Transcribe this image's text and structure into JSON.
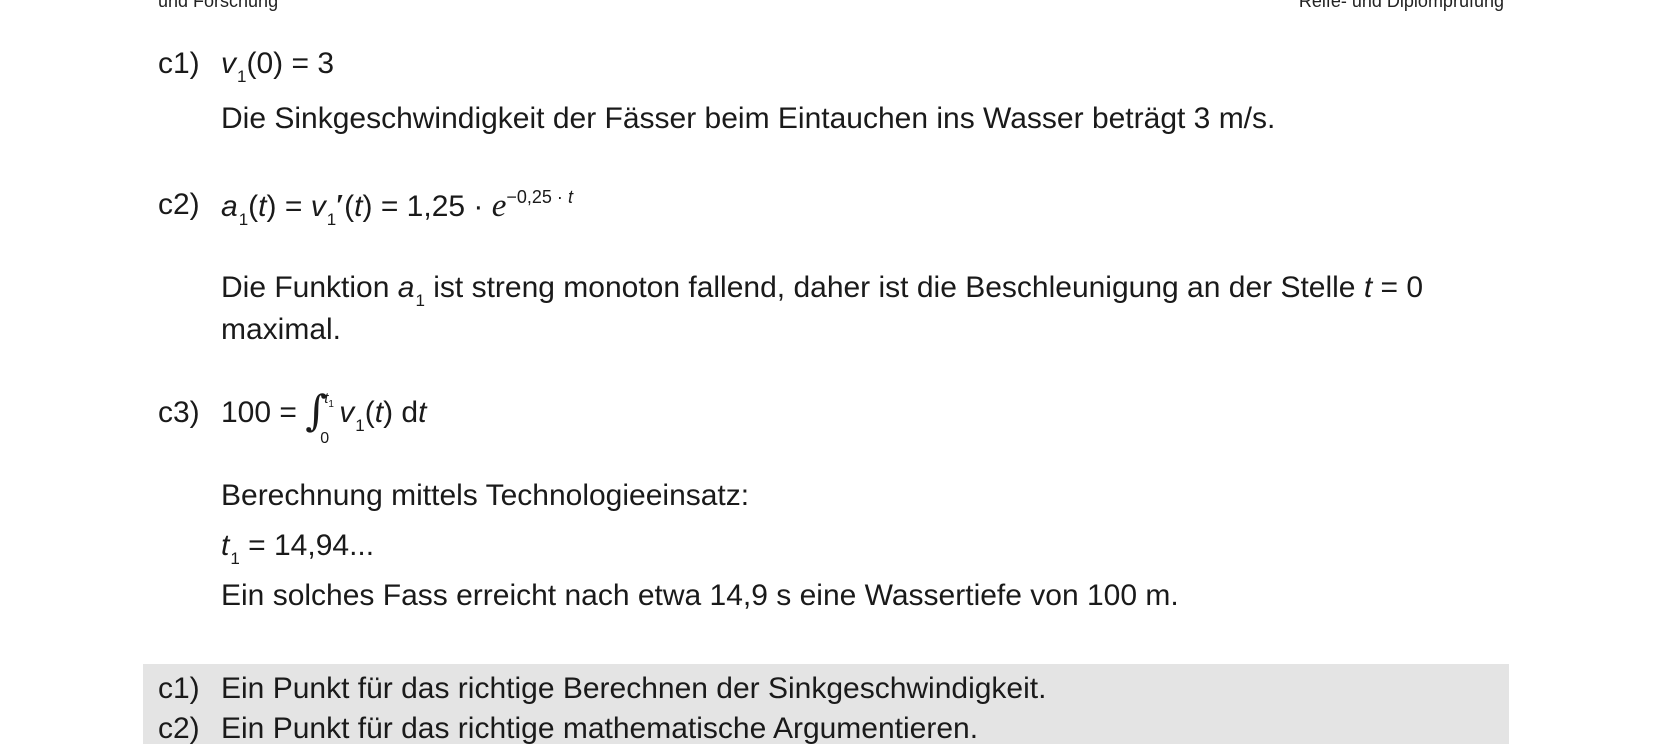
{
  "header": {
    "left": "und Forschung",
    "right": "Reife- und Diplomprüfung"
  },
  "solutions": {
    "c1": {
      "label": "c1)",
      "f_var": "v",
      "f_sub": "1",
      "f_rest": "(0) = 3",
      "text": "Die Sinkgeschwindigkeit der Fässer beim Eintauchen ins Wasser beträgt 3 m/s."
    },
    "c2": {
      "label": "c2)",
      "a": "a",
      "sub1": "1",
      "open": "(",
      "t": "t",
      "close_eq": ") = ",
      "v": "v",
      "sub2": "1",
      "prime": "′",
      "open2": "(",
      "t2": "t",
      "rhs": ") = 1,25 · ",
      "e": "e",
      "exp": "−0,25 · ",
      "exp_t": "t",
      "text_1a": "Die Funktion ",
      "text_1b": "a",
      "text_1c": "1",
      "text_1d": " ist streng monoton fallend, daher ist die Beschleunigung an der Stelle ",
      "text_1e": "t",
      "text_1f": " = 0",
      "text_2": "maximal."
    },
    "c3": {
      "label": "c3)",
      "lhs": "100 = ",
      "integral": "∫",
      "upper_t": "t",
      "upper_sub": "1",
      "lower": "0",
      "v": "v",
      "v_sub": "1",
      "open": "(",
      "t": "t",
      "close": ") d",
      "dt": "t",
      "line1": "Berechnung mittels Technologieeinsatz:",
      "t1_var": "t",
      "t1_sub": "1",
      "t1_rest": " = 14,94...",
      "line3": "Ein solches Fass erreicht nach etwa 14,9 s eine Wassertiefe von 100 m."
    }
  },
  "grading": {
    "c1_label": "c1)",
    "c1_text": "Ein Punkt für das richtige Berechnen der Sinkgeschwindigkeit.",
    "c2_label": "c2)",
    "c2_text": "Ein Punkt für das richtige mathematische Argumentieren."
  },
  "colors": {
    "grading_background": "#e4e4e4",
    "text": "#1a1a1a"
  }
}
